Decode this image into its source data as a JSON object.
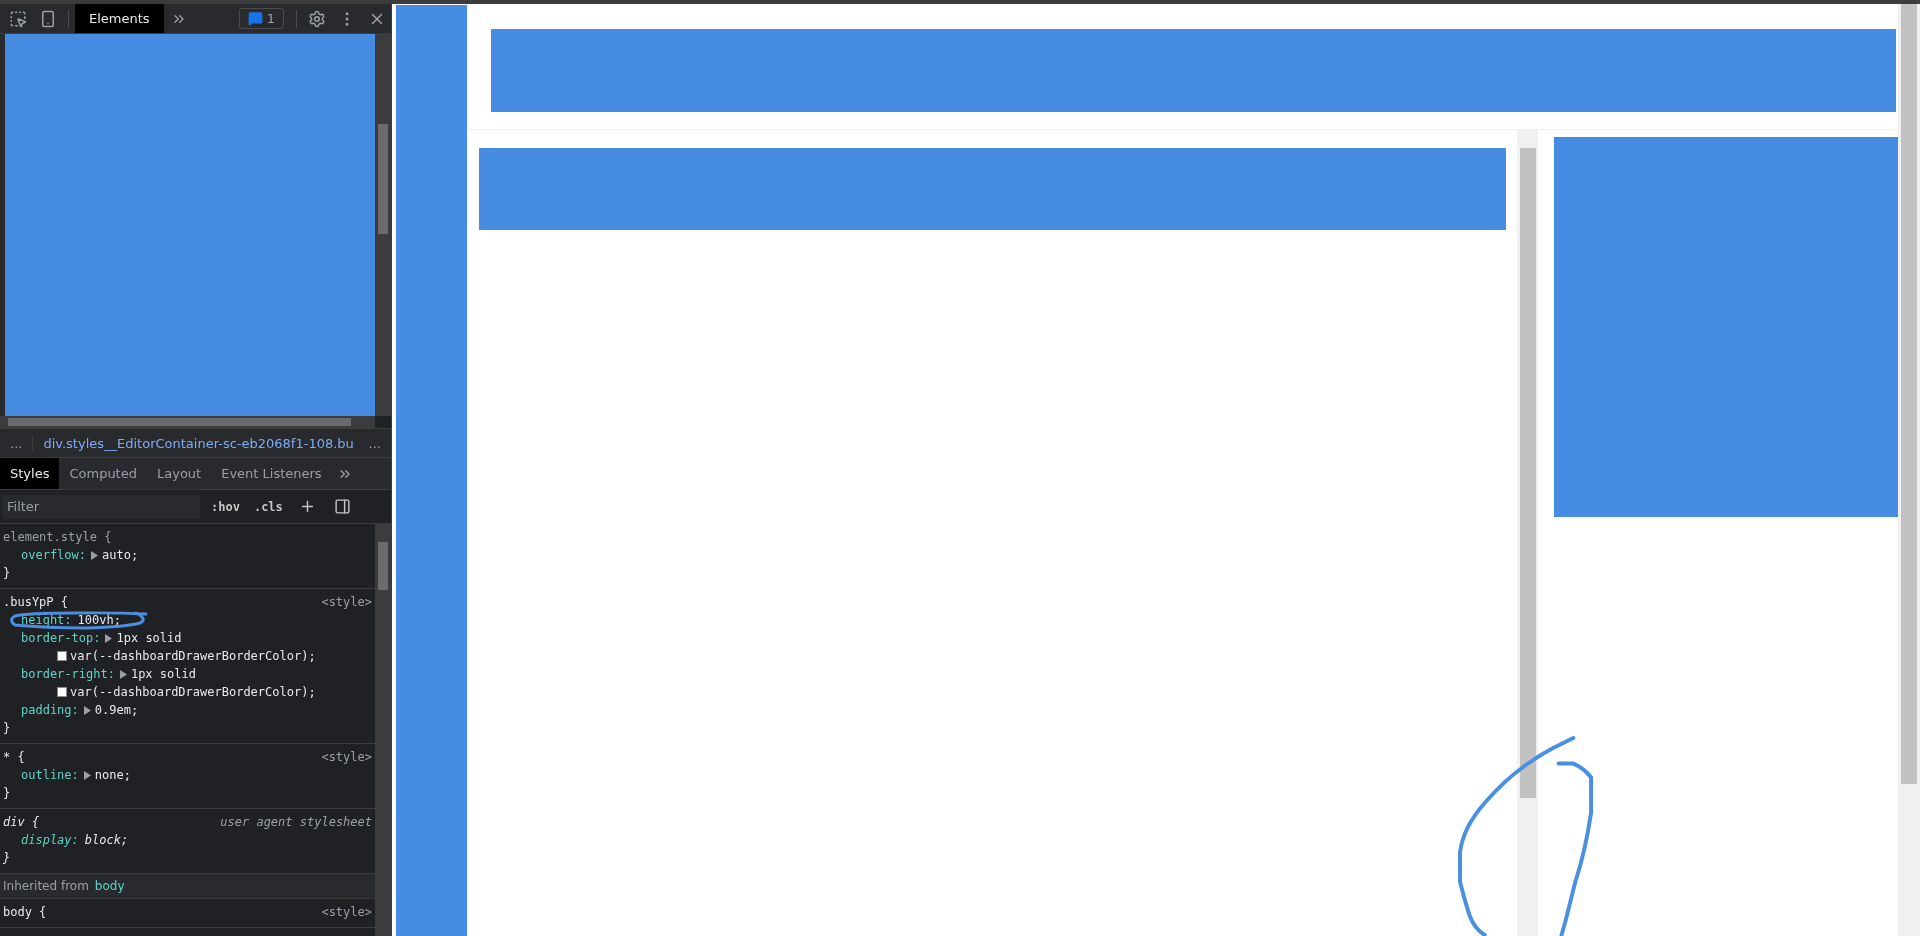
{
  "devtools": {
    "toolbar": {
      "tabs": [
        {
          "label": "Elements",
          "selected": true
        }
      ],
      "issues_count": "1"
    },
    "breadcrumb": {
      "more_left": "...",
      "path": "div.styles__EditorContainer-sc-eb2068f1-108.bu",
      "more_right": "..."
    },
    "panel_tabs": [
      {
        "label": "Styles",
        "selected": true
      },
      {
        "label": "Computed",
        "selected": false
      },
      {
        "label": "Layout",
        "selected": false
      },
      {
        "label": "Event Listeners",
        "selected": false
      }
    ],
    "filter": {
      "placeholder": "Filter"
    },
    "filter_buttons": [
      ":hov",
      ".cls"
    ],
    "rules": [
      {
        "kind": "inline",
        "selector": "element.style {",
        "declarations": [
          {
            "name": "overflow:",
            "value": "auto;",
            "expandable": true
          }
        ],
        "close": "}"
      },
      {
        "kind": "style",
        "selector": ".busYpP {",
        "source": "<style>",
        "declarations": [
          {
            "name": "height:",
            "value": "100vh;",
            "expandable": false
          },
          {
            "name": "border-top:",
            "value": "1px solid",
            "expandable": true,
            "swatch_value": "var(--dashboardDrawerBorderColor);"
          },
          {
            "name": "border-right:",
            "value": "1px solid",
            "expandable": true,
            "swatch_value": "var(--dashboardDrawerBorderColor);"
          },
          {
            "name": "padding:",
            "value": "0.9em;",
            "expandable": true
          }
        ],
        "close": "}"
      },
      {
        "kind": "style",
        "selector": "* {",
        "source": "<style>",
        "declarations": [
          {
            "name": "outline:",
            "value": "none;",
            "expandable": true
          }
        ],
        "close": "}"
      },
      {
        "kind": "agent",
        "selector": "div {",
        "source": "user agent stylesheet",
        "declarations": [
          {
            "name": "display:",
            "value": "block;",
            "expandable": false
          }
        ],
        "close": "}"
      },
      {
        "kind": "inherited",
        "label": "Inherited from",
        "link": "body"
      },
      {
        "kind": "style",
        "selector": "body {",
        "source": "<style>"
      }
    ]
  }
}
